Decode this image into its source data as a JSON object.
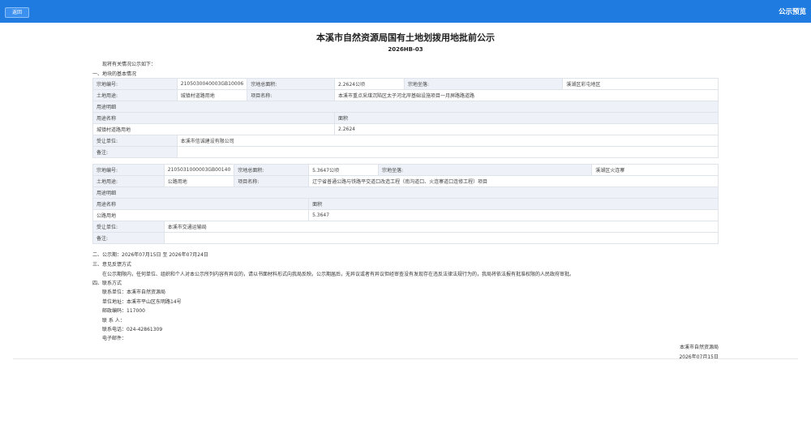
{
  "topbar": {
    "back_label": "返回",
    "title": "公示预览"
  },
  "doc": {
    "title": "本溪市自然资源局国有土地划拨用地批前公示",
    "number": "2026HB-03"
  },
  "intro": "现将有关情况公示如下：",
  "section1": "一、地块的基本情况",
  "labels": {
    "parcel_no": "宗地编号:",
    "total_area": "宗地总面积:",
    "location": "宗地坐落:",
    "land_use": "土地用途:",
    "project_name": "项目名称:",
    "use_detail": "用途明细",
    "use_name": "用途名称",
    "area": "面积",
    "transferee": "受让单位:",
    "remarks": "备注:"
  },
  "parcels": [
    {
      "no": "2105030040003GB10006",
      "area": "2.2624公顷",
      "location": "溪湖区彩屯地区",
      "use": "城镇村道路用地",
      "project": "本溪市重点采煤沉陷区太子河北岸基础设施项目一月屏路路道路",
      "detail_name": "城镇村道路用地",
      "detail_area": "2.2624",
      "transferee": "本溪市信诚建设有限公司",
      "remarks": ""
    },
    {
      "no": "2105031000003GB00140",
      "area": "5.3647公顷",
      "location": "溪湖区火连寨",
      "use": "公路用地",
      "project": "辽宁省普通公路与铁路平交道口改造工程（南沟道口、火连寨道口连修工程）项目",
      "detail_name": "公路用地",
      "detail_area": "5.3647",
      "transferee": "本溪市交通运输局",
      "remarks": ""
    }
  ],
  "section2": "二、公示期：2026年07月15日 至 2026年07月24日",
  "section3": "三、意见反馈方式",
  "section3_text": "在公示期限内，任何单位、组织和个人对本公示所列内容有异议的，请以书面材料形式向我局反映。公示期届后，无异议或者有异议但经审查没有发现存在违反法律法规行为的，我局将依法报有批准权限的人民政府审批。",
  "section4": "四、联系方式",
  "contacts": [
    "联系单位：本溪市自然资源局",
    "单位地址：本溪市平山区东明路14号",
    "邮政编码：117000",
    "联 系 人：",
    "联系电话：024-42861309",
    "电子邮件："
  ],
  "signature": {
    "org": "本溪市自然资源局",
    "date": "2026年07月15日"
  }
}
